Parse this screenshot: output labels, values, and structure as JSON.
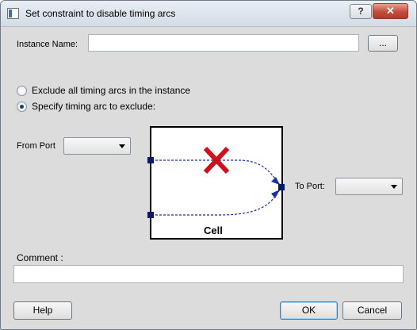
{
  "window": {
    "title": "Set constraint to disable timing arcs",
    "help_label": "?",
    "close_label": "✕"
  },
  "instance": {
    "label": "Instance Name:",
    "value": "",
    "browse_label": "..."
  },
  "options": {
    "exclude_all_label": "Exclude all timing arcs in the instance",
    "specify_label": "Specify timing arc to exclude:",
    "selected": "specify"
  },
  "from_port": {
    "label": "From Port",
    "value": ""
  },
  "to_port": {
    "label": "To Port:",
    "value": ""
  },
  "diagram": {
    "cell_label": "Cell",
    "colors": {
      "arc": "#1f2fa3",
      "cross": "#d0101a",
      "pin": "#0b1a66"
    }
  },
  "comment": {
    "label": "Comment :",
    "value": ""
  },
  "footer": {
    "help_label": "Help",
    "ok_label": "OK",
    "cancel_label": "Cancel"
  }
}
